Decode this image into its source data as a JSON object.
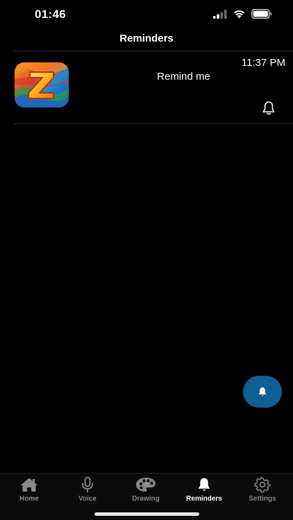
{
  "status_bar": {
    "time": "01:46",
    "icons": [
      "signal-icon",
      "wifi-icon",
      "battery-icon"
    ]
  },
  "header": {
    "title": "Reminders"
  },
  "reminders": [
    {
      "time": "11:37 PM",
      "title": "Remind me",
      "icon": "app-logo-z-icon",
      "action_icon": "bell-icon"
    }
  ],
  "fab": {
    "icon": "bell-icon",
    "color": "#0f5f93"
  },
  "tab_bar": {
    "active": "Reminders",
    "active_color": "#ffffff",
    "inactive_color": "#8a8a8a",
    "tabs": [
      {
        "label": "Home",
        "icon": "home-icon"
      },
      {
        "label": "Voice",
        "icon": "microphone-icon"
      },
      {
        "label": "Drawing",
        "icon": "palette-icon"
      },
      {
        "label": "Reminders",
        "icon": "bell-icon"
      },
      {
        "label": "Settings",
        "icon": "gear-icon"
      }
    ]
  }
}
